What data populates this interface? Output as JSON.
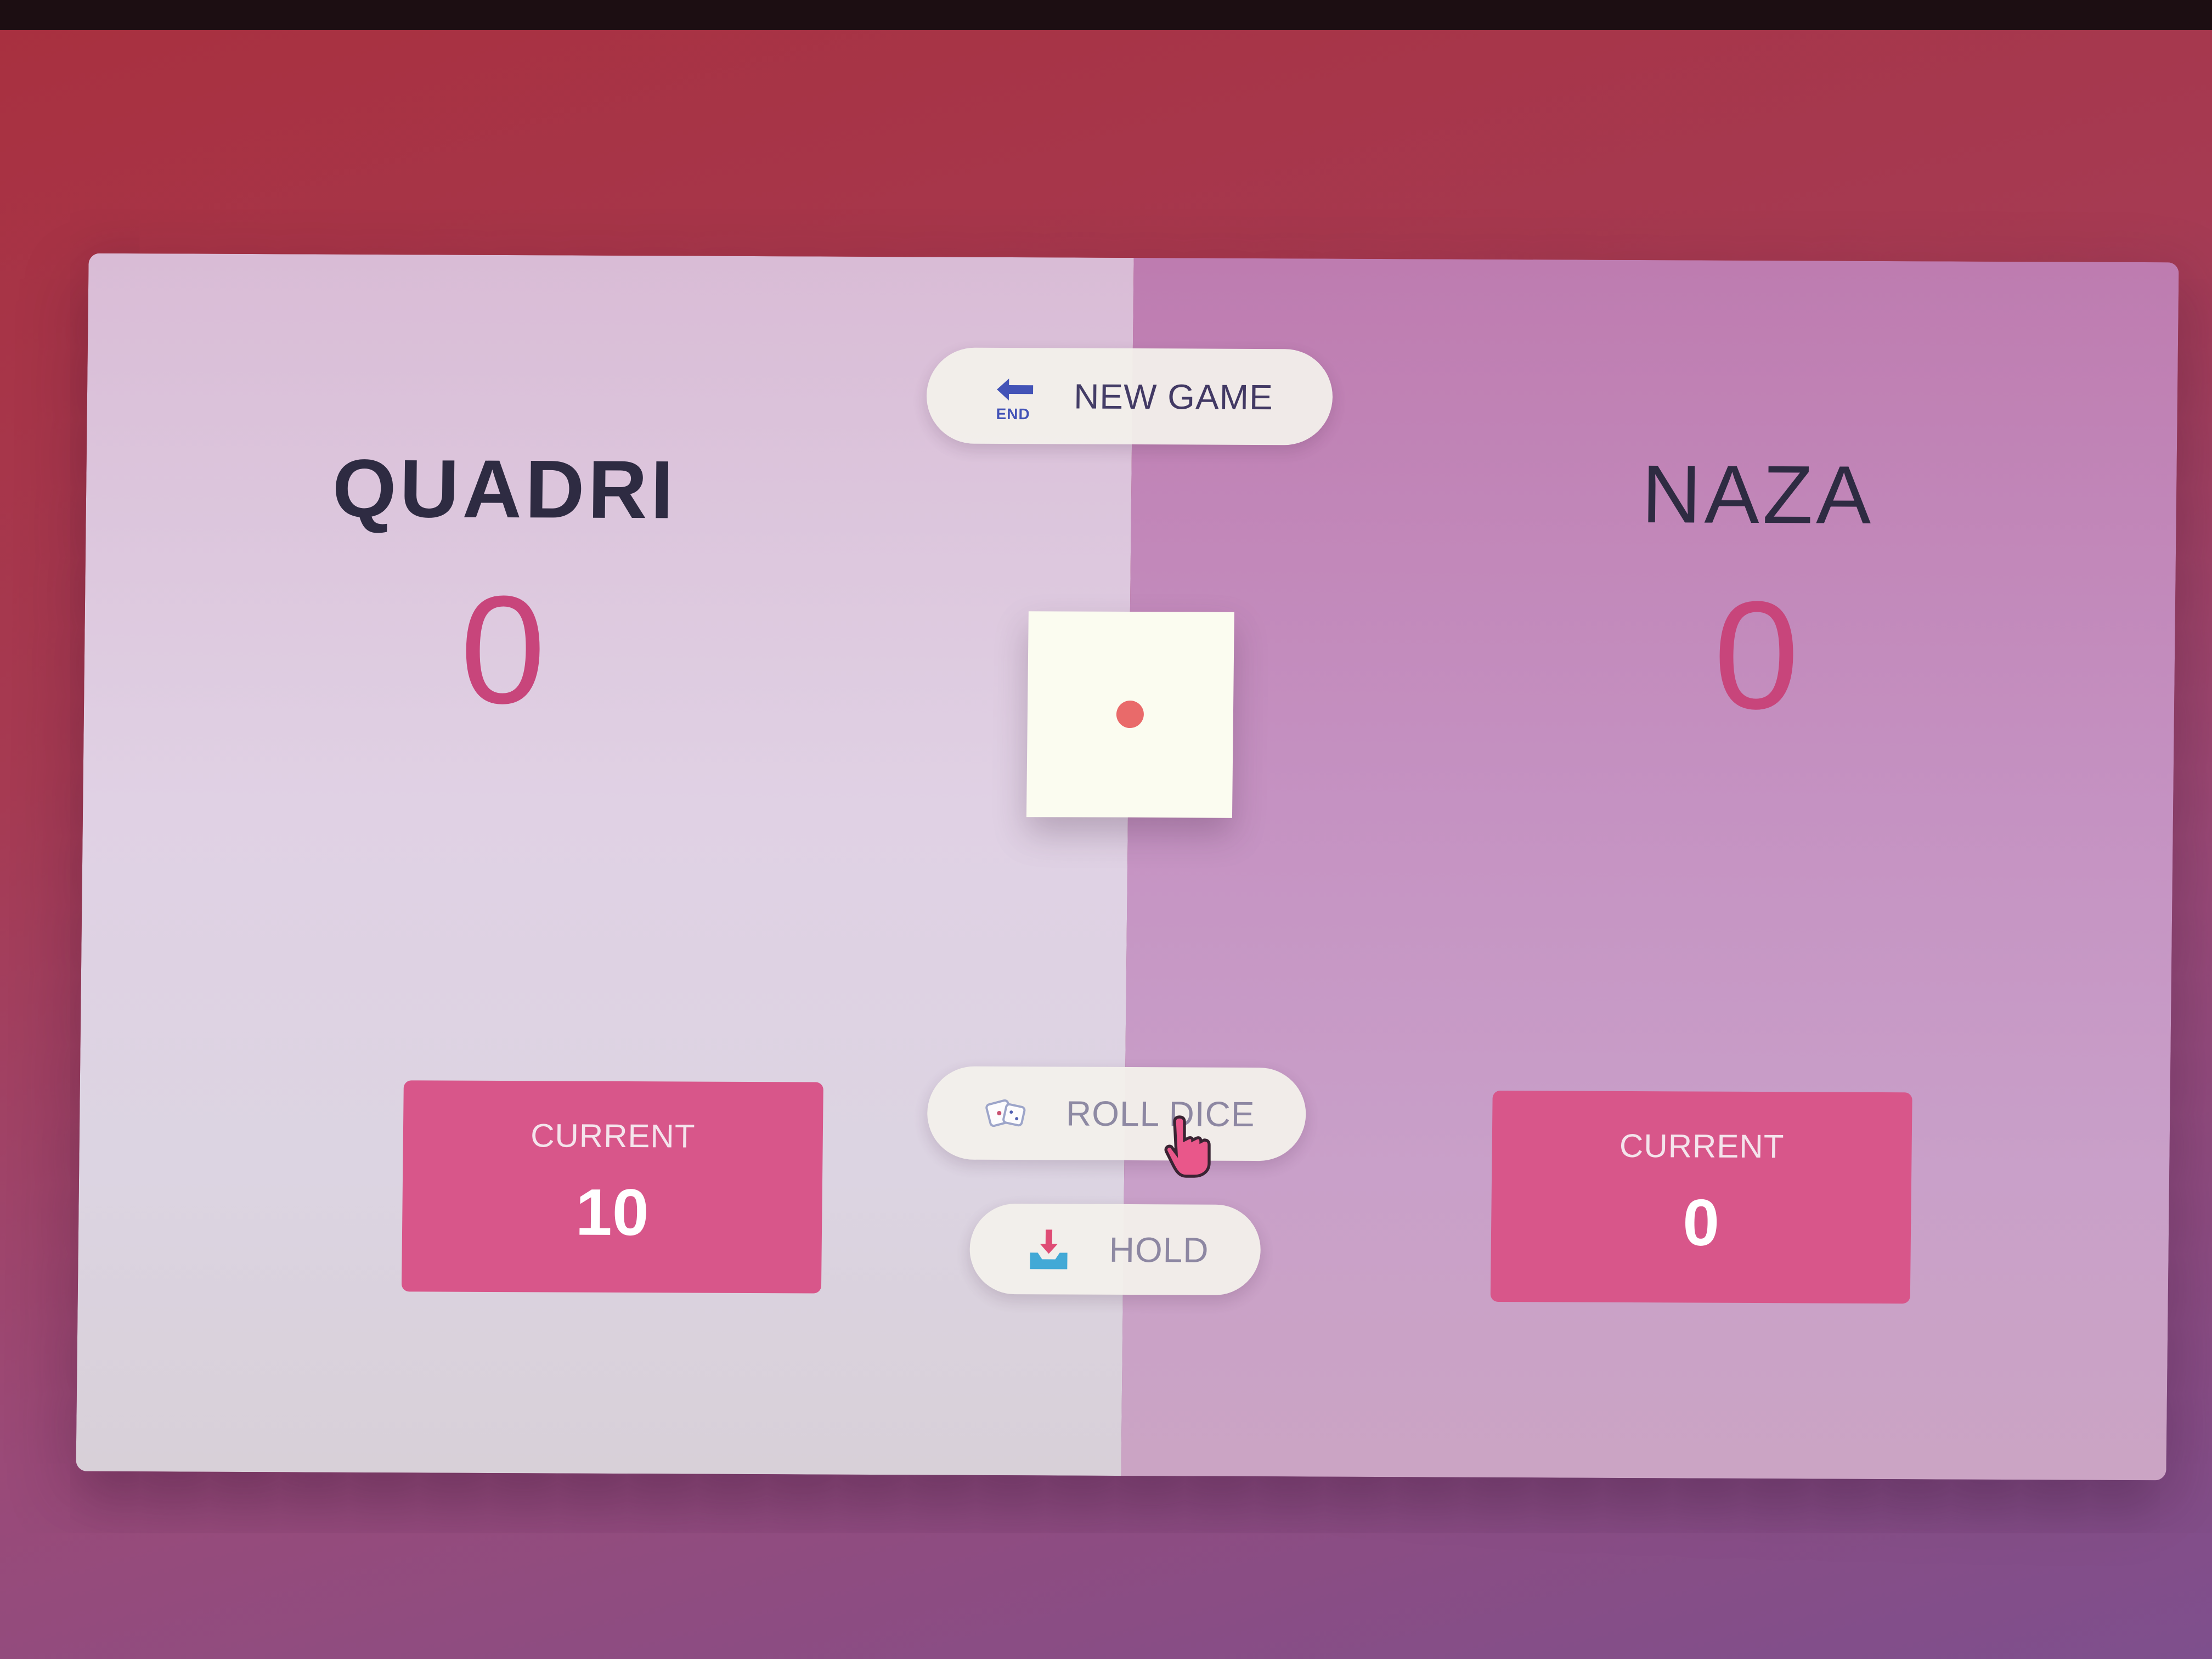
{
  "players": [
    {
      "name": "QUADRI",
      "score": "0",
      "current_label": "CURRENT",
      "current_score": "10"
    },
    {
      "name": "NAZA",
      "score": "0",
      "current_label": "CURRENT",
      "current_score": "0"
    }
  ],
  "controls": {
    "new_game": {
      "label": "NEW GAME",
      "icon": "end-arrow-icon"
    },
    "roll_dice": {
      "label": "ROLL DICE",
      "icon": "dice-icon"
    },
    "hold": {
      "label": "HOLD",
      "icon": "inbox-tray-icon"
    }
  },
  "dice": {
    "value": 1,
    "face_icon": "dice-face-one-icon"
  },
  "colors": {
    "accent": "#d8568a",
    "score": "#c8457b",
    "text_dark": "#2e2b42",
    "button_bg": "#f4f1ec",
    "dice_pip": "#e96a6a"
  }
}
